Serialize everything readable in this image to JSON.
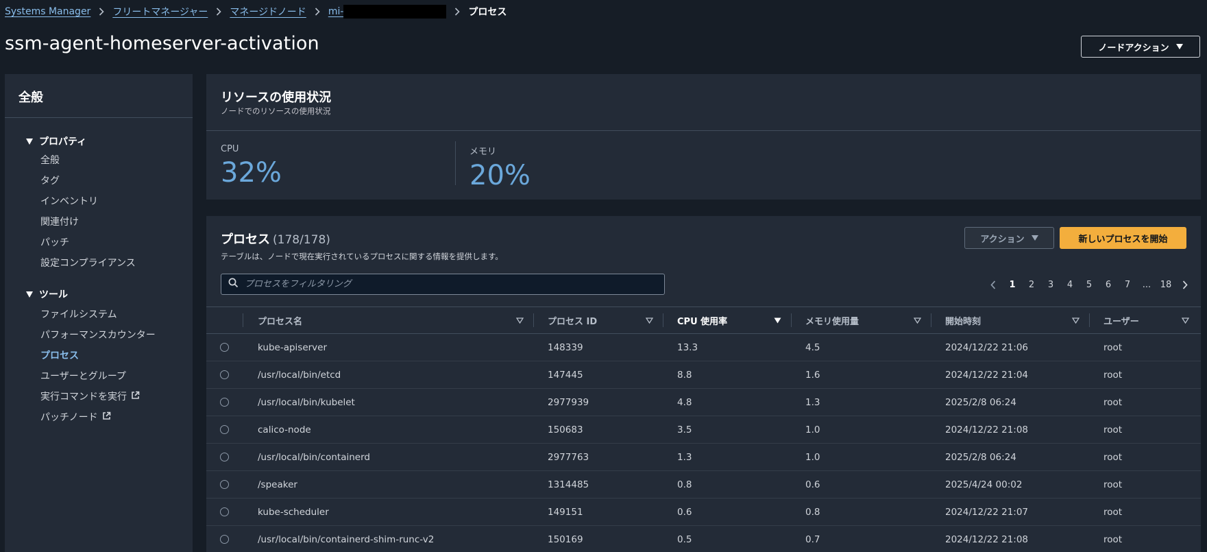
{
  "breadcrumb": {
    "items": [
      "Systems Manager",
      "フリートマネージャー",
      "マネージドノード",
      "mi-"
    ],
    "current": "プロセス"
  },
  "page": {
    "title": "ssm-agent-homeserver-activation",
    "node_action_label": "ノードアクション"
  },
  "sidebar": {
    "header": "全般",
    "sections": [
      {
        "label": "プロパティ",
        "items": [
          "全般",
          "タグ",
          "インベントリ",
          "関連付け",
          "パッチ",
          "設定コンプライアンス"
        ]
      },
      {
        "label": "ツール",
        "items": [
          "ファイルシステム",
          "パフォーマンスカウンター",
          "プロセス",
          "ユーザーとグループ",
          "実行コマンドを実行",
          "パッチノード"
        ]
      }
    ],
    "active_item": "プロセス"
  },
  "resources": {
    "title": "リソースの使用状況",
    "subtitle": "ノードでのリソースの使用状況",
    "cpu_label": "CPU",
    "cpu_value": "32%",
    "memory_label": "メモリ",
    "memory_value": "20%"
  },
  "processes": {
    "title": "プロセス",
    "count": "(178/178)",
    "description": "テーブルは、ノードで現在実行されているプロセスに関する情報を提供します。",
    "action_label": "アクション",
    "new_label": "新しいプロセスを開始",
    "filter_placeholder": "プロセスをフィルタリング",
    "pagination": [
      "1",
      "2",
      "3",
      "4",
      "5",
      "6",
      "7",
      "...",
      "18"
    ],
    "current_page": "1",
    "columns": [
      "プロセス名",
      "プロセス ID",
      "CPU 使用率",
      "メモリ使用量",
      "開始時刻",
      "ユーザー"
    ],
    "sorted_column": "CPU 使用率",
    "rows": [
      [
        "kube-apiserver",
        "148339",
        "13.3",
        "4.5",
        "2024/12/22 21:06",
        "root"
      ],
      [
        "/usr/local/bin/etcd",
        "147445",
        "8.8",
        "1.6",
        "2024/12/22 21:04",
        "root"
      ],
      [
        "/usr/local/bin/kubelet",
        "2977939",
        "4.8",
        "1.3",
        "2025/2/8 06:24",
        "root"
      ],
      [
        "calico-node",
        "150683",
        "3.5",
        "1.0",
        "2024/12/22 21:08",
        "root"
      ],
      [
        "/usr/local/bin/containerd",
        "2977763",
        "1.3",
        "1.0",
        "2025/2/8 06:24",
        "root"
      ],
      [
        "/speaker",
        "1314485",
        "0.8",
        "0.6",
        "2025/4/24 00:02",
        "root"
      ],
      [
        "kube-scheduler",
        "149151",
        "0.6",
        "0.8",
        "2024/12/22 21:07",
        "root"
      ],
      [
        "/usr/local/bin/containerd-shim-runc-v2",
        "150169",
        "0.5",
        "0.7",
        "2024/12/22 21:08",
        "root"
      ]
    ]
  },
  "colors": {
    "background": "#161d26",
    "panel": "#232b37",
    "link": "#89bdeb",
    "metric": "#6ba8db",
    "primary_button": "#f3ae3d"
  }
}
